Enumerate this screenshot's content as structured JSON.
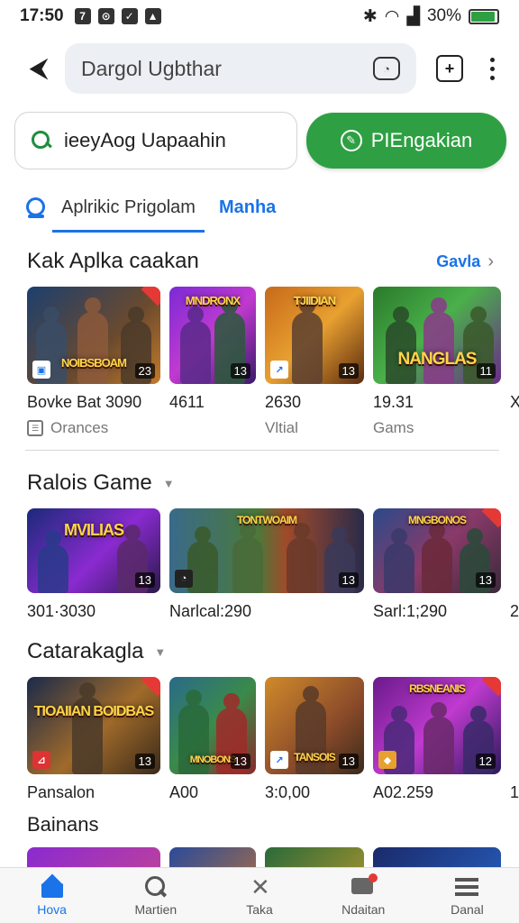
{
  "status": {
    "time": "17:50",
    "left_icons": [
      "7",
      "⊙",
      "✓",
      "▲"
    ],
    "battery": "30%",
    "battery_level": 0.3
  },
  "toolbar": {
    "url_text": "Dargol Ugbthar",
    "back_icon": "back-arrow",
    "tab_icon": "tab-switcher",
    "menu_icon": "overflow-menu"
  },
  "search": {
    "value": "ieeyAog Uapaahin",
    "button_label": "PIEngakian"
  },
  "tabs": [
    {
      "label": "Aplrikic Prigolam",
      "active": true
    },
    {
      "label": "Manha",
      "active": false
    }
  ],
  "sections": [
    {
      "title": "Kak Aplka caakan",
      "link": "Gavla",
      "cards": [
        {
          "art": "NOIBSBOAM",
          "badge": "23",
          "label": "Bovke Bat 3090",
          "sub": "Orances",
          "sub_icon": true
        },
        {
          "art": "MNDRONX",
          "badge": "13",
          "label": "4611",
          "sub": ""
        },
        {
          "art": "TJIIDIAN",
          "badge": "13",
          "label": "2630",
          "sub": "Vltial"
        },
        {
          "art": "NANGLAS",
          "badge": "11",
          "label": "19.31",
          "sub": "Gams"
        }
      ],
      "peek": "X"
    },
    {
      "title": "Ralois Game",
      "cards": [
        {
          "art": "MVILIAS",
          "badge": "13",
          "label": "301·3030"
        },
        {
          "art": "TONTWOAIM",
          "badge": "13",
          "label": "Narlcal:290"
        },
        {
          "art": "MNGBONOS",
          "badge": "13",
          "label": "Sarl:1;290"
        }
      ],
      "peek": "2"
    },
    {
      "title": "Catarakagla",
      "cards": [
        {
          "art": "TIOAIIAN BOIDBAS",
          "badge": "13",
          "label": "Pansalon"
        },
        {
          "art": "MNOBONS",
          "badge": "13",
          "label": "A00"
        },
        {
          "art": "TANSOIS",
          "badge": "13",
          "label": "3:0,00"
        },
        {
          "art": "RBSNEANIS",
          "badge": "12",
          "label": "A02.259"
        }
      ],
      "peek": "1"
    },
    {
      "title": "Bainans"
    }
  ],
  "bottom_nav": [
    {
      "label": "Hova",
      "icon": "home-icon",
      "active": true
    },
    {
      "label": "Martien",
      "icon": "search-icon",
      "active": false
    },
    {
      "label": "Taka",
      "icon": "tools-icon",
      "active": false
    },
    {
      "label": "Ndaitan",
      "icon": "chat-icon",
      "active": false
    },
    {
      "label": "Danal",
      "icon": "menu-icon",
      "active": false
    }
  ],
  "colors": {
    "accent": "#1a73e8",
    "primary_button": "#2ea043",
    "badge": "#e53935"
  }
}
